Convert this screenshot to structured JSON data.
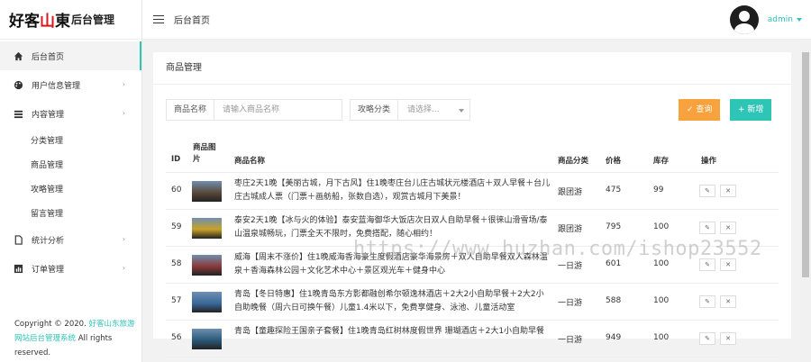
{
  "brand": {
    "logo_text": "后台管理"
  },
  "header": {
    "title": "后台首页",
    "username": "admin"
  },
  "sidebar": {
    "items": [
      {
        "label": "后台首页",
        "icon": "home-icon",
        "active": true
      },
      {
        "label": "用户信息管理",
        "icon": "palette-icon",
        "arrow": "›"
      },
      {
        "label": "内容管理",
        "icon": "list-icon",
        "arrow": "›"
      }
    ],
    "subitems": [
      "分类管理",
      "商品管理",
      "攻略管理",
      "留言管理"
    ],
    "items_bottom": [
      {
        "label": "统计分析",
        "icon": "file-icon",
        "arrow": "›"
      },
      {
        "label": "订单管理",
        "icon": "chart-icon",
        "arrow": "›"
      }
    ],
    "copyright_prefix": "Copyright © 2020.",
    "copyright_link": "好客山东旅游网站后台管理系统",
    "copyright_suffix": "All rights reserved."
  },
  "main": {
    "title": "商品管理",
    "filters": {
      "name_label": "商品名称",
      "name_placeholder": "请输入商品名称",
      "category_label": "攻略分类",
      "category_placeholder": "请选择..."
    },
    "buttons": {
      "query": "查询",
      "add": "新增"
    },
    "columns": [
      "ID",
      "商品图片",
      "商品名称",
      "商品分类",
      "价格",
      "库存",
      "操作"
    ],
    "rows": [
      {
        "id": "60",
        "name": "枣庄2天1晚【美丽古城，月下古风】住1晚枣庄台儿庄古城状元楼酒店＋双人早餐＋台儿庄古城成人票（门票＋画舫船，张数自选），观赏古城月下美景！",
        "category": "跟团游",
        "price": "475",
        "stock": "99",
        "thumb": "#5a4a3a"
      },
      {
        "id": "59",
        "name": "泰安2天1晚【冰与火的体验】泰安蓝海御华大饭店次日双人自助早餐＋很徕山滑雪场/泰山温泉城畅玩，门票全天不限时，免费搭配，随心相约！",
        "category": "跟团游",
        "price": "795",
        "stock": "100",
        "thumb": "#c9a227"
      },
      {
        "id": "58",
        "name": "威海【周末不涨价】住1晚威海香海豪生度假酒店豪华海景房＋双人自助早餐双人森林温泉＋香海森林公园＋文化艺术中心＋景区观光车＋健身中心",
        "category": "一日游",
        "price": "601",
        "stock": "100",
        "thumb": "#8a3a3a"
      },
      {
        "id": "57",
        "name": "青岛【冬日特惠】住1晚青岛东方影都融创希尔顿逸林酒店＋2大2小自助早餐＋2大2小自助晚餐（周六日可换午餐）儿童1.4米以下，免费享健身、泳池、儿童活动室",
        "category": "一日游",
        "price": "588",
        "stock": "100",
        "thumb": "#3a6a9a"
      },
      {
        "id": "56",
        "name": "青岛【童趣探险王国亲子套餐】住1晚青岛红树林度假世界 珊瑚酒店＋2大1小自助早餐",
        "category": "一日游",
        "price": "949",
        "stock": "100",
        "thumb": "#2a5a7a"
      }
    ],
    "ops": {
      "edit": "✎",
      "delete": "✕"
    }
  },
  "watermark": "https://www.huzhan.com/ishop23552",
  "colors": {
    "accent": "#2ec4b6",
    "query": "#f7a23d",
    "brand_red": "#d9161b"
  }
}
